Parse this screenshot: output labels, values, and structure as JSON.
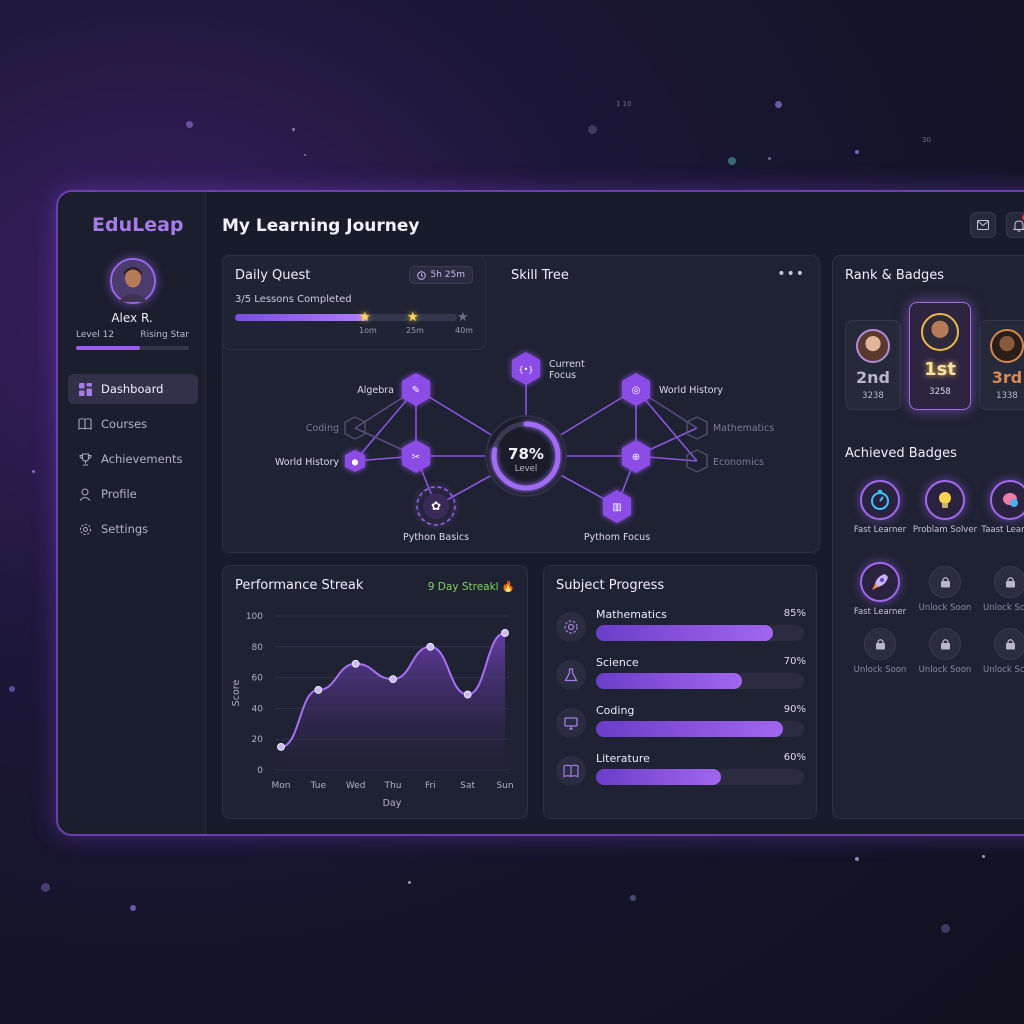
{
  "app": {
    "brand": "EduLeap",
    "page_title": "My Learning Journey",
    "header_icons": [
      "mail-icon",
      "bell-icon"
    ]
  },
  "user": {
    "name": "Alex R.",
    "level": "Level 12",
    "title": "Rising Star",
    "level_progress": 0.57
  },
  "sidebar": {
    "items": [
      {
        "label": "Dashboard",
        "icon": "grid-icon",
        "active": true
      },
      {
        "label": "Courses",
        "icon": "book-icon",
        "active": false
      },
      {
        "label": "Achievements",
        "icon": "trophy-icon",
        "active": false
      },
      {
        "label": "Profile",
        "icon": "user-icon",
        "active": false
      },
      {
        "label": "Settings",
        "icon": "gear-icon",
        "active": false
      }
    ]
  },
  "daily_quest": {
    "title": "Daily Quest",
    "timer": "5h 25m",
    "subtitle": "3/5 Lessons Completed",
    "progress": 0.6,
    "markers": [
      "1om",
      "25m",
      "40m"
    ]
  },
  "skill_tree": {
    "title": "Skill Tree",
    "menu_icon": "more-horizontal-icon",
    "center_value": "78%",
    "center_label": "Level",
    "center_progress": 0.78,
    "nodes": [
      {
        "label": "Current Focus",
        "state": "active"
      },
      {
        "label": "Algebra",
        "state": "active"
      },
      {
        "label": "World History",
        "state": "active"
      },
      {
        "label": "Coding",
        "state": "locked"
      },
      {
        "label": "Mathematics",
        "state": "locked"
      },
      {
        "label": "World History",
        "state": "active"
      },
      {
        "label": "Economics",
        "state": "locked"
      },
      {
        "label": "Python Basics",
        "state": "active"
      },
      {
        "label": "Pythom Focus",
        "state": "active"
      }
    ]
  },
  "rank": {
    "title": "Rank & Badges",
    "entries": [
      {
        "position": "2nd",
        "points": "3238"
      },
      {
        "position": "1st",
        "points": "3258"
      },
      {
        "position": "3rd",
        "points": "1338"
      }
    ]
  },
  "badges": {
    "title": "Achieved Badges",
    "items": [
      {
        "label": "Fast Learner",
        "icon": "stopwatch-icon",
        "unlocked": true
      },
      {
        "label": "Problam Solver",
        "icon": "lightbulb-icon",
        "unlocked": true
      },
      {
        "label": "Taast Learner",
        "icon": "brain-icon",
        "unlocked": true
      },
      {
        "label": "Fast Learner",
        "icon": "rocket-icon",
        "unlocked": true
      },
      {
        "label": "Unlock Soon",
        "icon": "lock-icon",
        "unlocked": false
      },
      {
        "label": "Unlock Sc",
        "icon": "lock-icon",
        "unlocked": false
      },
      {
        "label": "Unlock Soon",
        "icon": "lock-icon",
        "unlocked": false
      },
      {
        "label": "Unlock Soon",
        "icon": "lock-icon",
        "unlocked": false
      },
      {
        "label": "Unlock Sc",
        "icon": "lock-icon",
        "unlocked": false
      }
    ]
  },
  "performance": {
    "title": "Performance Streak",
    "streak": "9 Day Streakl 🔥"
  },
  "chart_data": {
    "type": "area",
    "title": "",
    "xlabel": "Day",
    "ylabel": "Score",
    "categories": [
      "Mon",
      "Tue",
      "Wed",
      "Thu",
      "Fri",
      "Sat",
      "Sun"
    ],
    "values": [
      15,
      52,
      69,
      59,
      80,
      49,
      89
    ],
    "ylim": [
      0,
      100
    ],
    "yticks": [
      0,
      20,
      40,
      60,
      80,
      100
    ],
    "grid": true,
    "colors": {
      "line": "#a770f5",
      "fill": "#6b3fb0"
    }
  },
  "subject_progress": {
    "title": "Subject Progress",
    "items": [
      {
        "name": "Mathematics",
        "value": "85%",
        "progress": 0.85,
        "icon": "gear-icon"
      },
      {
        "name": "Science",
        "value": "70%",
        "progress": 0.7,
        "icon": "flask-icon"
      },
      {
        "name": "Coding",
        "value": "90%",
        "progress": 0.9,
        "icon": "monitor-icon"
      },
      {
        "name": "Literature",
        "value": "60%",
        "progress": 0.6,
        "icon": "open-book-icon"
      }
    ]
  },
  "background_text": [
    "1 10",
    "30"
  ]
}
